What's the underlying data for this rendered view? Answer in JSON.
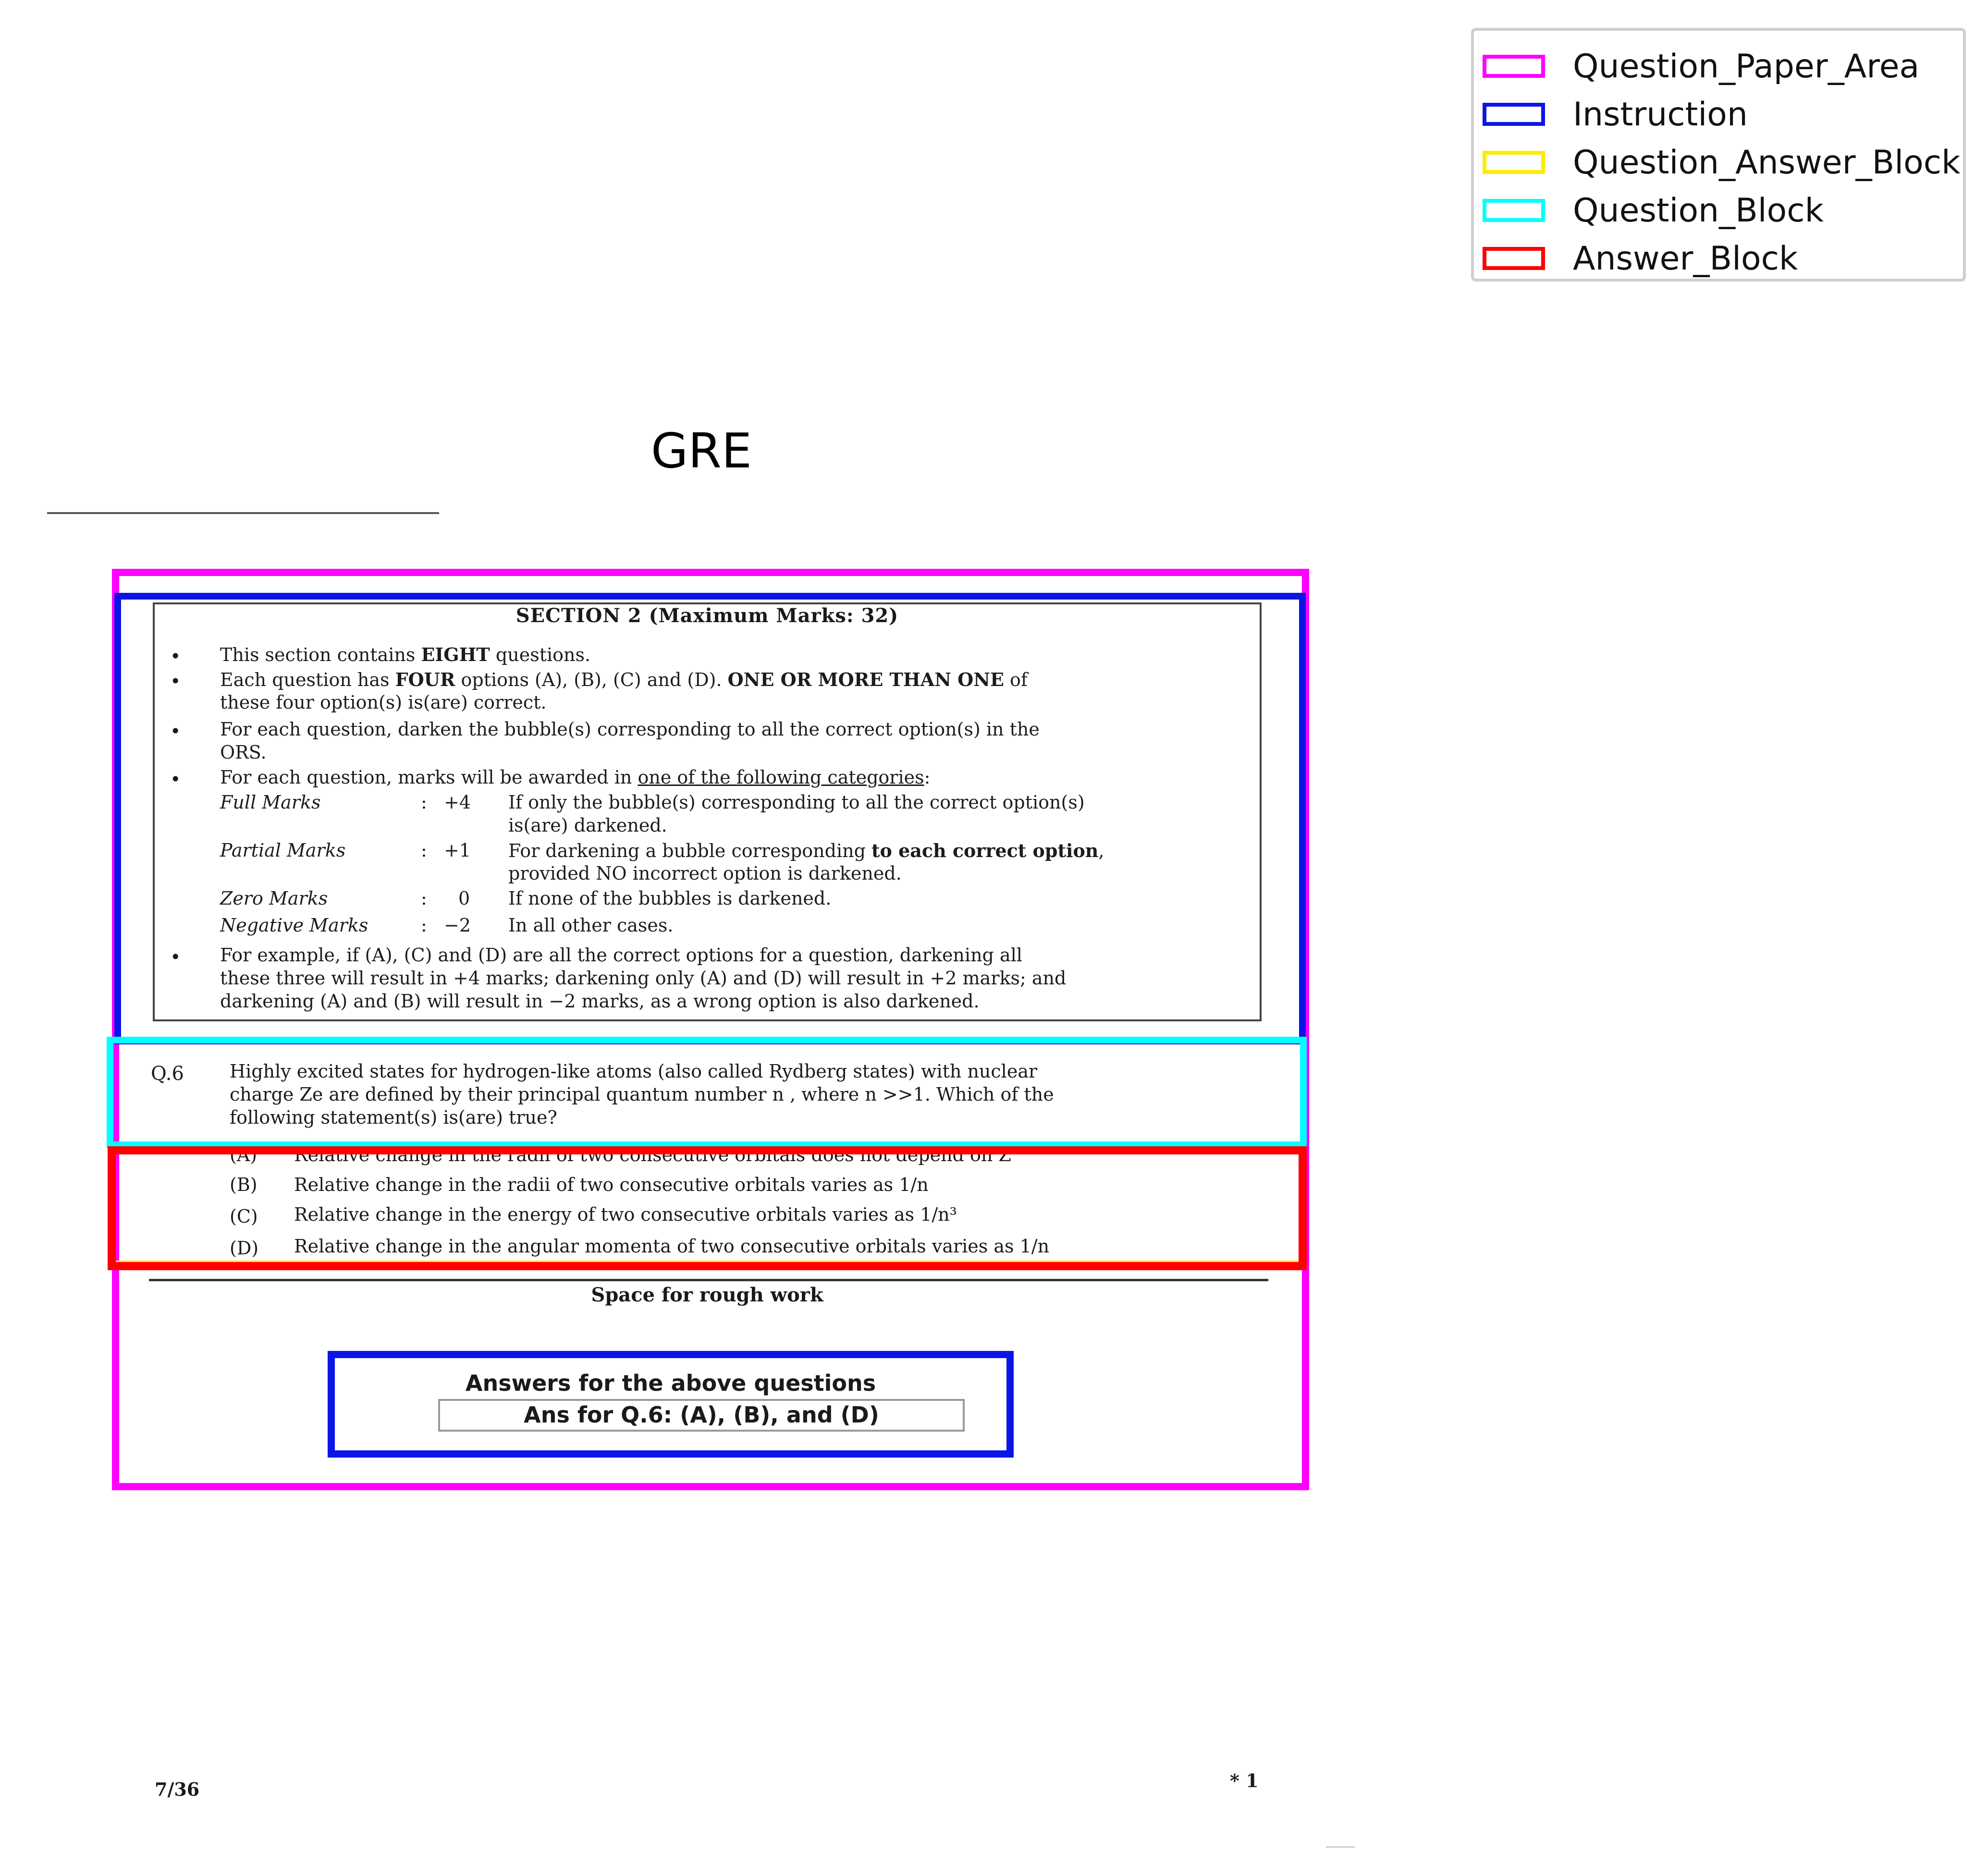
{
  "legend": {
    "items": [
      {
        "label": "Question_Paper_Area",
        "color": "#ff00ff"
      },
      {
        "label": "Instruction",
        "color": "#0b16e6"
      },
      {
        "label": "Question_Answer_Block",
        "color": "#ffeb00"
      },
      {
        "label": "Question_Block",
        "color": "#00ffff"
      },
      {
        "label": "Answer_Block",
        "color": "#ff0000"
      }
    ]
  },
  "title": "GRE",
  "instructions": {
    "heading": "SECTION 2 (Maximum Marks: 32)",
    "b1_pre": "This section contains ",
    "b1_bold": "EIGHT",
    "b1_post": " questions.",
    "b2_l1_pre": "Each question has ",
    "b2_l1_bold1": "FOUR",
    "b2_l1_mid": " options (A), (B), (C) and (D). ",
    "b2_l1_bold2": "ONE OR MORE THAN ONE",
    "b2_l1_post": " of",
    "b2_l2": "these four option(s) is(are) correct.",
    "b3_l1": "For each question, darken the bubble(s) corresponding to all the correct option(s) in the",
    "b3_l2": "ORS.",
    "b4_pre": "For each question, marks will be awarded in ",
    "b4_underline": "one of the following categories",
    "b4_post": ":",
    "marks": [
      {
        "name": "Full Marks",
        "colon": ":",
        "value": "+4",
        "desc1": "If only the bubble(s) corresponding to all the correct option(s)",
        "desc2": "is(are) darkened."
      },
      {
        "name": "Partial Marks",
        "colon": ":",
        "value": "+1",
        "desc1_pre": "For darkening a bubble corresponding ",
        "desc1_bold": "to each correct option",
        "desc1_post": ",",
        "desc2": "provided NO incorrect option is darkened."
      },
      {
        "name": "Zero Marks",
        "colon": ":",
        "value": "0",
        "desc1": "If none of the bubbles is darkened."
      },
      {
        "name": "Negative Marks",
        "colon": ":",
        "value": "−2",
        "desc1": "In all other cases."
      }
    ],
    "b5_l1": "For example, if (A), (C) and (D) are all the correct options for a question, darkening all",
    "b5_l2": "these three will result in +4 marks; darkening only (A) and (D) will result in +2 marks; and",
    "b5_l3": "darkening (A) and (B) will result in −2 marks, as a wrong option is also darkened."
  },
  "question": {
    "number": "Q.6",
    "line1": "Highly excited states for hydrogen-like atoms (also called Rydberg states) with nuclear",
    "line2": "charge Ze are defined by their principal quantum number n , where n >>1. Which of the",
    "line3": "following statement(s) is(are) true?"
  },
  "options": [
    {
      "label": "(A)",
      "text": "Relative change in the radii of two consecutive orbitals does not depend on Z"
    },
    {
      "label": "(B)",
      "text": "Relative change in the radii of two consecutive orbitals varies as 1/n"
    },
    {
      "label": "(C)",
      "text": "Relative change in the energy of two consecutive orbitals varies as 1/n³"
    },
    {
      "label": "(D)",
      "text": "Relative change in the angular momenta of two consecutive orbitals varies as 1/n"
    }
  ],
  "rough_work": "Space for rough work",
  "answers": {
    "title": "Answers for the above questions",
    "text": "Ans for Q.6: (A), (B), and (D)"
  },
  "footer": {
    "page": "7/36",
    "code": "* 1"
  }
}
